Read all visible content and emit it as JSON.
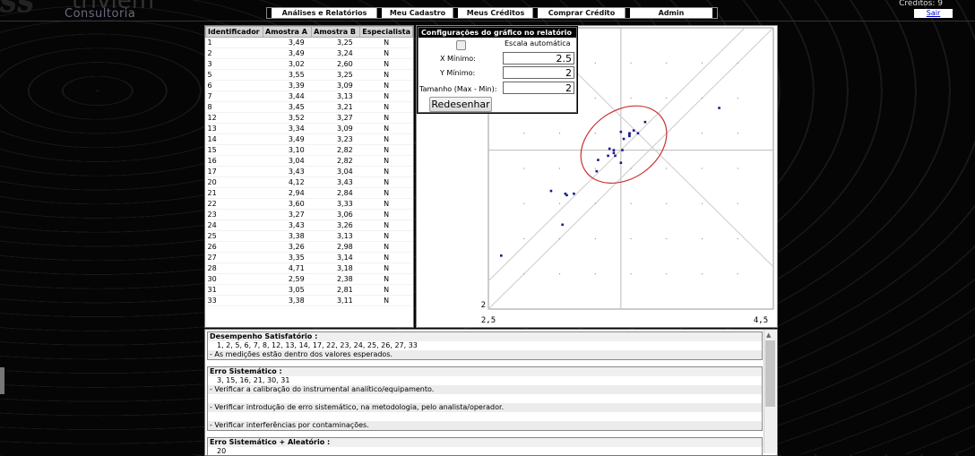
{
  "header": {
    "logo_mark": "SS",
    "logo_name": "triviem",
    "logo_sub": "Consultoria",
    "nav": [
      "Análises e Relatórios",
      "Meu Cadastro",
      "Meus Créditos",
      "Comprar Crédito",
      "Admin"
    ],
    "credits": "Créditos: 9",
    "logout": "Sair"
  },
  "table": {
    "headers": [
      "Identificador",
      "Amostra A",
      "Amostra B",
      "Especialista"
    ],
    "rows": [
      [
        "1",
        "3,49",
        "3,25",
        "N"
      ],
      [
        "2",
        "3,49",
        "3,24",
        "N"
      ],
      [
        "3",
        "3,02",
        "2,60",
        "N"
      ],
      [
        "5",
        "3,55",
        "3,25",
        "N"
      ],
      [
        "6",
        "3,39",
        "3,09",
        "N"
      ],
      [
        "7",
        "3,44",
        "3,13",
        "N"
      ],
      [
        "8",
        "3,45",
        "3,21",
        "N"
      ],
      [
        "12",
        "3,52",
        "3,27",
        "N"
      ],
      [
        "13",
        "3,34",
        "3,09",
        "N"
      ],
      [
        "14",
        "3,49",
        "3,23",
        "N"
      ],
      [
        "15",
        "3,10",
        "2,82",
        "N"
      ],
      [
        "16",
        "3,04",
        "2,82",
        "N"
      ],
      [
        "17",
        "3,43",
        "3,04",
        "N"
      ],
      [
        "20",
        "4,12",
        "3,43",
        "N"
      ],
      [
        "21",
        "2,94",
        "2,84",
        "N"
      ],
      [
        "22",
        "3,60",
        "3,33",
        "N"
      ],
      [
        "23",
        "3,27",
        "3,06",
        "N"
      ],
      [
        "24",
        "3,43",
        "3,26",
        "N"
      ],
      [
        "25",
        "3,38",
        "3,13",
        "N"
      ],
      [
        "26",
        "3,26",
        "2,98",
        "N"
      ],
      [
        "27",
        "3,35",
        "3,14",
        "N"
      ],
      [
        "28",
        "4,71",
        "3,18",
        "N"
      ],
      [
        "30",
        "2,59",
        "2,38",
        "N"
      ],
      [
        "31",
        "3,05",
        "2,81",
        "N"
      ],
      [
        "33",
        "3,38",
        "3,11",
        "N"
      ]
    ]
  },
  "config": {
    "title": "Configurações do gráfico no relatório",
    "auto_label": "Escala automática",
    "xmin_label": "X Mínimo:",
    "xmin_value": "2.5",
    "ymin_label": "Y Mínimo:",
    "ymin_value": "2",
    "size_label": "Tamanho (Max - Min):",
    "size_value": "2",
    "redraw": "Redesenhar"
  },
  "chart_data": {
    "type": "scatter",
    "xlim": [
      2.5,
      4.5
    ],
    "ylim": [
      2,
      4
    ],
    "x_tick_labels": [
      "2,5",
      "4,5"
    ],
    "y_tick_labels": [
      "2"
    ],
    "points": [
      [
        3.49,
        3.25
      ],
      [
        3.49,
        3.24
      ],
      [
        3.02,
        2.6
      ],
      [
        3.55,
        3.25
      ],
      [
        3.39,
        3.09
      ],
      [
        3.44,
        3.13
      ],
      [
        3.45,
        3.21
      ],
      [
        3.52,
        3.27
      ],
      [
        3.34,
        3.09
      ],
      [
        3.49,
        3.23
      ],
      [
        3.1,
        2.82
      ],
      [
        3.04,
        2.82
      ],
      [
        3.43,
        3.04
      ],
      [
        4.12,
        3.43
      ],
      [
        2.94,
        2.84
      ],
      [
        3.6,
        3.33
      ],
      [
        3.27,
        3.06
      ],
      [
        3.43,
        3.26
      ],
      [
        3.38,
        3.13
      ],
      [
        3.26,
        2.98
      ],
      [
        3.35,
        3.14
      ],
      [
        3.05,
        2.81
      ],
      [
        3.38,
        3.11
      ],
      [
        2.59,
        2.38
      ]
    ],
    "ellipse_color": "#c83232",
    "point_color": "#1a1a8c"
  },
  "report": {
    "sections": [
      {
        "title": "Desempenho Satisfatório :",
        "ids": "1, 2, 5, 6, 7, 8, 12, 13, 14, 17, 22, 23, 24, 25, 26, 27, 33",
        "notes": [
          "- As medições estão dentro dos valores esperados."
        ]
      },
      {
        "title": "Erro Sistemático :",
        "ids": "3, 15, 16, 21, 30, 31",
        "notes": [
          "- Verificar a calibração do instrumental analítico/equipamento.",
          "",
          "- Verificar introdução de erro sistemático, na metodologia, pelo analista/operador.",
          "",
          "- Verificar interferências por contaminações."
        ]
      },
      {
        "title": "Erro Sistemático + Aleatório :",
        "ids": "20",
        "notes": []
      }
    ]
  }
}
